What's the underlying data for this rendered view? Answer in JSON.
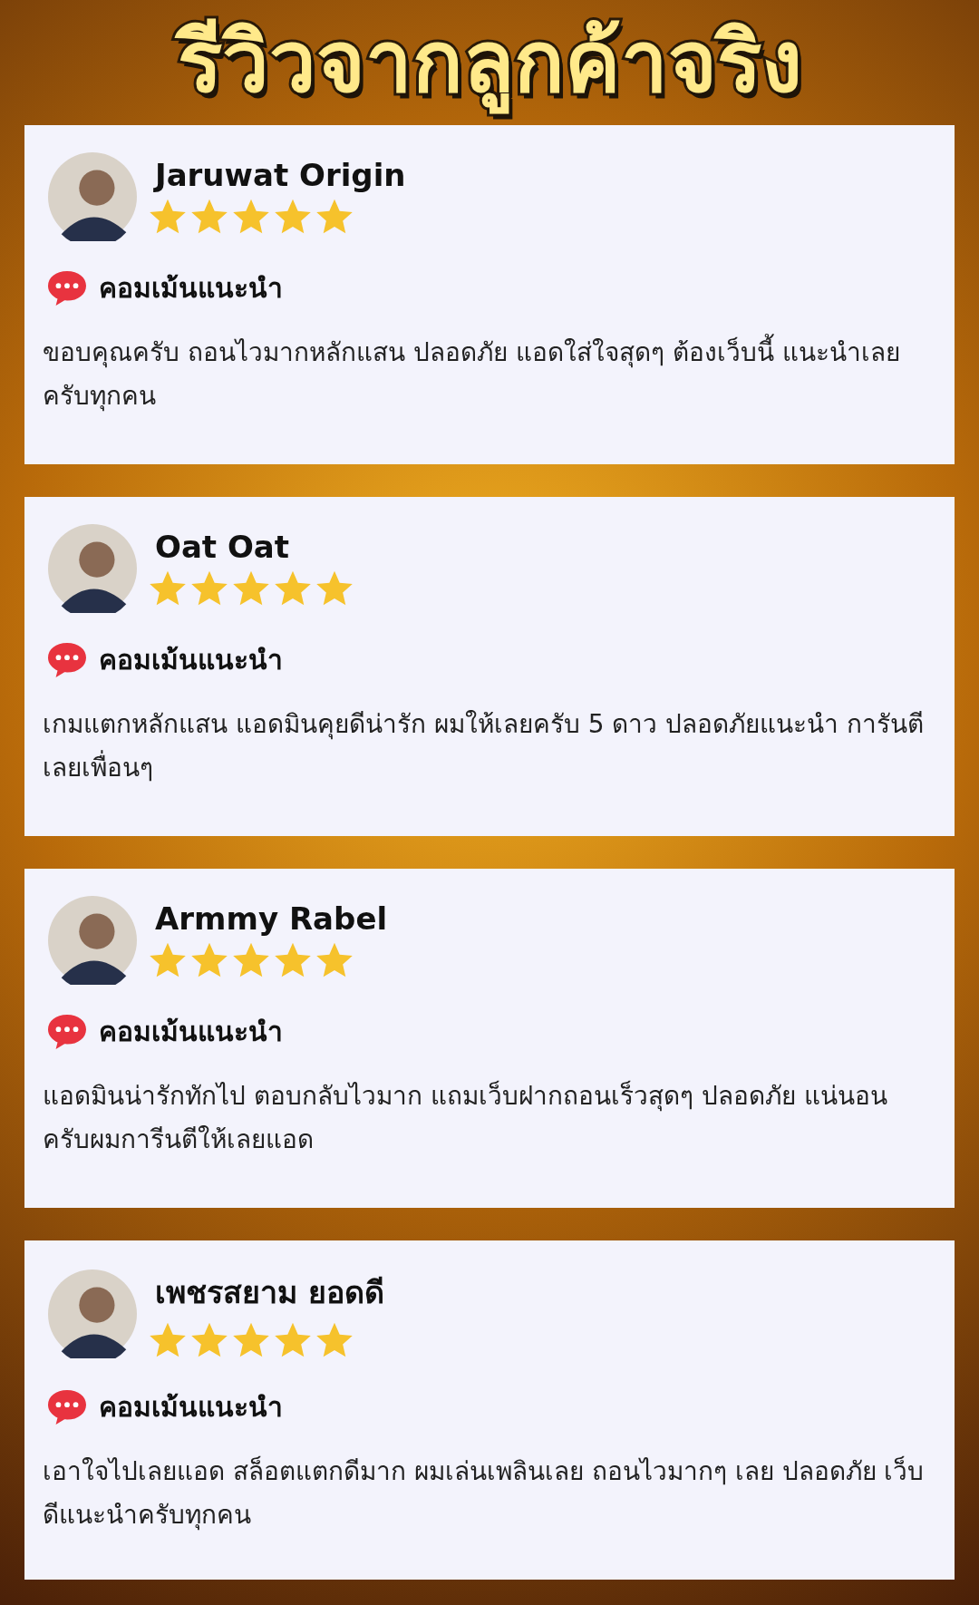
{
  "title": "รีวิวจากลูกค้าจริง",
  "reviews": [
    {
      "name": "Jaruwat Origin",
      "stars": 5,
      "label": "คอมเม้นแนะนำ",
      "text": "ขอบคุณครับ ถอนไวมากหลักแสน ปลอดภัย แอดใส่ใจสุดๆ ต้องเว็บนี้ แนะนำเลยครับทุกคน"
    },
    {
      "name": "Oat Oat",
      "stars": 5,
      "label": "คอมเม้นแนะนำ",
      "text": "เกมแตกหลักแสน แอดมินคุยดีน่ารัก ผมให้เลยครับ 5 ดาว ปลอดภัยแนะนำ การันตีเลยเพื่อนๆ"
    },
    {
      "name": "Armmy Rabel",
      "stars": 5,
      "label": "คอมเม้นแนะนำ",
      "text": "แอดมินน่ารักทักไป ตอบกลับไวมาก แถมเว็บฝากถอนเร็วสุดๆ ปลอดภัย แน่นอนครับผมการีนตีให้เลยแอด"
    },
    {
      "name": "เพชรสยาม ยอดดี",
      "stars": 5,
      "label": "คอมเม้นแนะนำ",
      "text": "เอาใจไปเลยแอด สล็อตแตกดีมาก ผมเล่นเพลินเลย ถอนไวมากๆ เลย ปลอดภัย เว็บดีแนะนำครับทุกคน"
    }
  ]
}
